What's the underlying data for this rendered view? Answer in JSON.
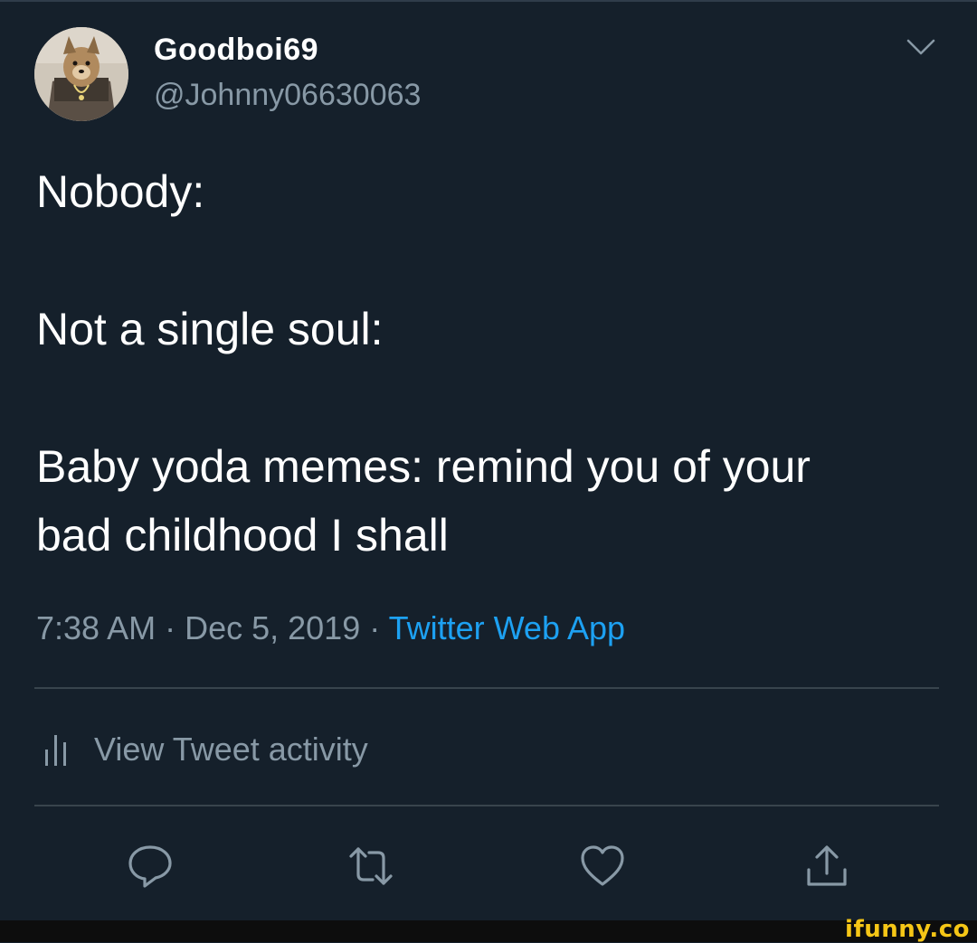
{
  "user": {
    "display_name": "Goodboi69",
    "handle": "@Johnny06630063",
    "avatar_icon": "dog-avatar"
  },
  "tweet": {
    "lines": [
      "Nobody:",
      "",
      "Not a single soul:",
      "",
      "Baby yoda memes: remind you of your",
      "bad childhood I shall"
    ]
  },
  "meta": {
    "time": "7:38 AM",
    "separator": " · ",
    "date": "Dec 5, 2019",
    "source": "Twitter Web App"
  },
  "activity": {
    "label": "View Tweet activity",
    "icon": "bar-chart-icon"
  },
  "actions": [
    {
      "name": "reply",
      "icon": "reply-icon"
    },
    {
      "name": "retweet",
      "icon": "retweet-icon"
    },
    {
      "name": "like",
      "icon": "heart-icon"
    },
    {
      "name": "share",
      "icon": "share-icon"
    }
  ],
  "watermark": "ifunny.co",
  "colors": {
    "background": "#15202b",
    "secondary_text": "#8899a6",
    "link": "#1da1f2",
    "divider": "#38444d",
    "watermark": "#f6c616"
  }
}
